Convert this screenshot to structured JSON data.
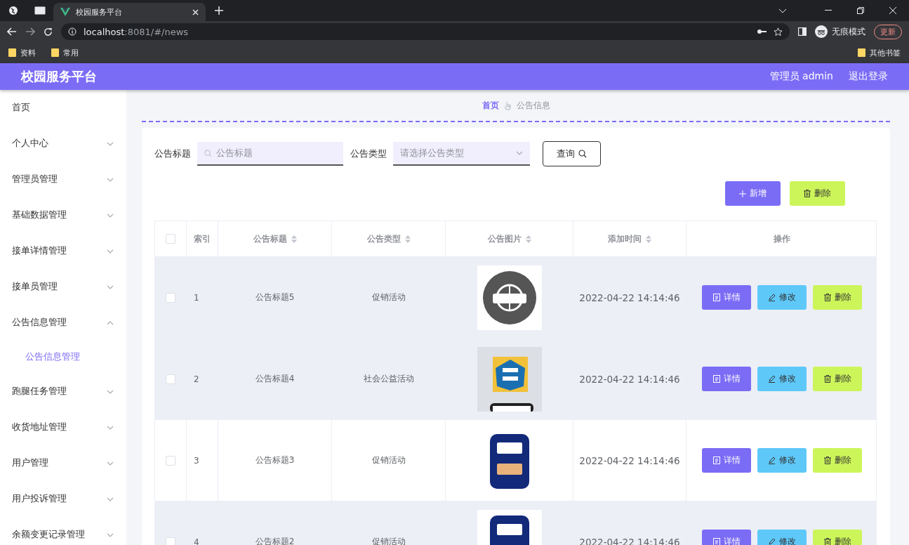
{
  "browser": {
    "tabs": [
      {
        "title": "校园服务平台",
        "selected": true
      }
    ],
    "address_host": "localhost",
    "address_rest": ":8081/#/news",
    "incognito": "无痕模式",
    "update": "更新",
    "bookmarks": [
      "资料",
      "常用"
    ],
    "other_bookmarks": "其他书签"
  },
  "header": {
    "title": "校园服务平台",
    "user": "管理员 admin",
    "logout": "退出登录"
  },
  "sidebar": {
    "items": [
      {
        "label": "首页",
        "kind": "link"
      },
      {
        "label": "个人中心",
        "kind": "submenu",
        "expanded": false
      },
      {
        "label": "管理员管理",
        "kind": "submenu",
        "expanded": false
      },
      {
        "label": "基础数据管理",
        "kind": "submenu",
        "expanded": false
      },
      {
        "label": "接单详情管理",
        "kind": "submenu",
        "expanded": false
      },
      {
        "label": "接单员管理",
        "kind": "submenu",
        "expanded": false
      },
      {
        "label": "公告信息管理",
        "kind": "submenu",
        "expanded": true,
        "children": [
          {
            "label": "公告信息管理",
            "selected": true
          }
        ]
      },
      {
        "label": "跑腿任务管理",
        "kind": "submenu",
        "expanded": false
      },
      {
        "label": "收货地址管理",
        "kind": "submenu",
        "expanded": false
      },
      {
        "label": "用户管理",
        "kind": "submenu",
        "expanded": false
      },
      {
        "label": "用户投诉管理",
        "kind": "submenu",
        "expanded": false
      },
      {
        "label": "余额变更记录管理",
        "kind": "submenu",
        "expanded": false
      }
    ]
  },
  "breadcrumb": [
    "首页",
    "公告信息"
  ],
  "search": {
    "fields": [
      {
        "label": "公告标题",
        "kind": "text",
        "placeholder": "公告标题"
      },
      {
        "label": "公告类型",
        "kind": "select",
        "placeholder": "请选择公告类型"
      }
    ],
    "button": "查询"
  },
  "toolbar": [
    {
      "label": "新增",
      "kind": "add"
    },
    {
      "label": "删除",
      "kind": "delete"
    }
  ],
  "table": {
    "columns": [
      {
        "kind": "checkbox",
        "checked": false
      },
      {
        "kind": "text",
        "label": "索引",
        "sortable": false
      },
      {
        "kind": "text",
        "label": "公告标题",
        "sortable": true
      },
      {
        "kind": "text",
        "label": "公告类型",
        "sortable": true
      },
      {
        "kind": "text",
        "label": "公告图片",
        "sortable": true
      },
      {
        "kind": "text",
        "label": "添加时间",
        "sortable": true
      },
      {
        "kind": "text",
        "label": "操作",
        "sortable": false
      }
    ],
    "rows": [
      {
        "checked": false,
        "shaded": true,
        "index": "1",
        "title": "公告标题5",
        "type": "促销活动",
        "image": {
          "kind": "picture"
        },
        "time": "2022-04-22 14:14:46",
        "actions": [
          {
            "label": "详情",
            "kind": "detail"
          },
          {
            "label": "修改",
            "kind": "edit"
          },
          {
            "label": "删除",
            "kind": "delete"
          }
        ]
      },
      {
        "checked": false,
        "shaded": true,
        "index": "2",
        "title": "公告标题4",
        "type": "社会公益活动",
        "image": {
          "kind": "picture"
        },
        "time": "2022-04-22 14:14:46",
        "actions": [
          {
            "label": "详情",
            "kind": "detail"
          },
          {
            "label": "修改",
            "kind": "edit"
          },
          {
            "label": "删除",
            "kind": "delete"
          }
        ]
      },
      {
        "checked": false,
        "shaded": false,
        "index": "3",
        "title": "公告标题3",
        "type": "促销活动",
        "image": {
          "kind": "picture"
        },
        "time": "2022-04-22 14:14:46",
        "actions": [
          {
            "label": "详情",
            "kind": "detail"
          },
          {
            "label": "修改",
            "kind": "edit"
          },
          {
            "label": "删除",
            "kind": "delete"
          }
        ]
      },
      {
        "checked": false,
        "shaded": true,
        "index": "4",
        "title": "公告标题2",
        "type": "促销活动",
        "image": {
          "kind": "picture"
        },
        "time": "2022-04-22 14:14:46",
        "actions": [
          {
            "label": "详情",
            "kind": "detail"
          },
          {
            "label": "修改",
            "kind": "edit"
          },
          {
            "label": "删除",
            "kind": "delete"
          }
        ]
      }
    ]
  }
}
